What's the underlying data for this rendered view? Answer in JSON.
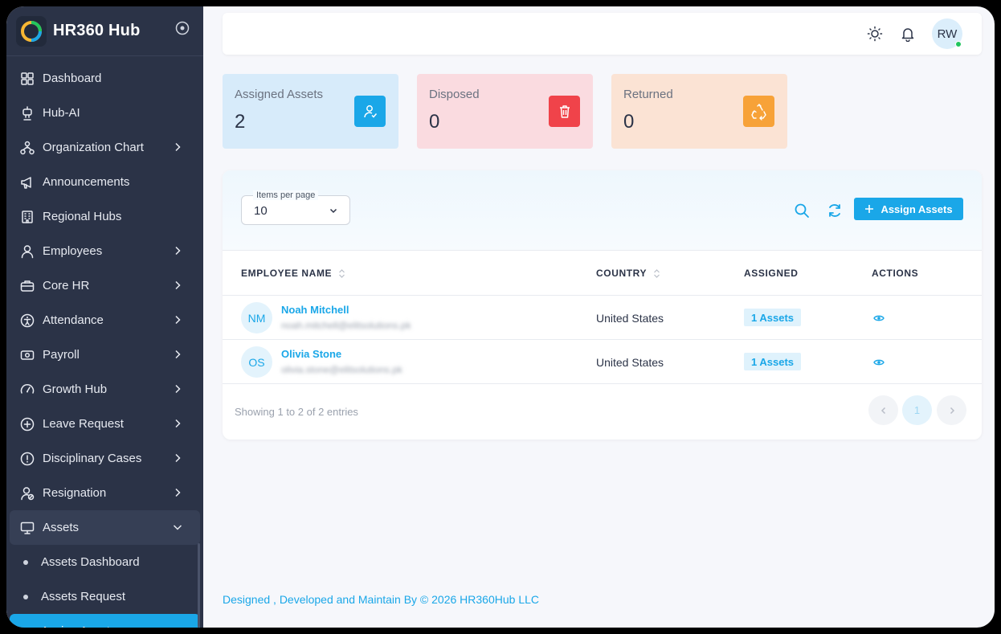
{
  "app": {
    "name": "HR360 Hub"
  },
  "sidebar": {
    "items": [
      {
        "label": "Dashboard",
        "icon": "dashboard-icon",
        "has_chevron": false
      },
      {
        "label": "Hub-AI",
        "icon": "robot-icon",
        "has_chevron": false
      },
      {
        "label": "Organization Chart",
        "icon": "org-chart-icon",
        "has_chevron": true
      },
      {
        "label": "Announcements",
        "icon": "megaphone-icon",
        "has_chevron": false
      },
      {
        "label": "Regional Hubs",
        "icon": "building-icon",
        "has_chevron": false
      },
      {
        "label": "Employees",
        "icon": "user-icon",
        "has_chevron": true
      },
      {
        "label": "Core HR",
        "icon": "briefcase-icon",
        "has_chevron": true
      },
      {
        "label": "Attendance",
        "icon": "accessibility-icon",
        "has_chevron": true
      },
      {
        "label": "Payroll",
        "icon": "money-icon",
        "has_chevron": true
      },
      {
        "label": "Growth Hub",
        "icon": "gauge-icon",
        "has_chevron": true
      },
      {
        "label": "Leave Request",
        "icon": "plus-circle-icon",
        "has_chevron": true
      },
      {
        "label": "Disciplinary Cases",
        "icon": "alert-circle-icon",
        "has_chevron": true
      },
      {
        "label": "Resignation",
        "icon": "user-remove-icon",
        "has_chevron": true
      }
    ],
    "open_item": {
      "label": "Assets",
      "icon": "monitor-icon"
    },
    "sub_items": [
      {
        "label": "Assets Dashboard"
      },
      {
        "label": "Assets Request"
      },
      {
        "label": "Assign Assets",
        "active": true
      }
    ]
  },
  "topbar": {
    "avatar_initials": "RW"
  },
  "stats": [
    {
      "label": "Assigned Assets",
      "value": "2",
      "bg": "#d7ebfa",
      "icon_bg": "#1aa7e8",
      "icon": "user-check-icon"
    },
    {
      "label": "Disposed",
      "value": "0",
      "bg": "#fadbe0",
      "icon_bg": "#f0434a",
      "icon": "trash-icon"
    },
    {
      "label": "Returned",
      "value": "0",
      "bg": "#fbe3d4",
      "icon_bg": "#f7a238",
      "icon": "recycle-icon"
    }
  ],
  "table": {
    "items_per_page_label": "Items per page",
    "items_per_page_value": "10",
    "assign_button": "Assign Assets",
    "headers": {
      "employee": "EMPLOYEE NAME",
      "country": "COUNTRY",
      "assigned": "ASSIGNED",
      "actions": "ACTIONS"
    },
    "rows": [
      {
        "initials": "NM",
        "name": "Noah Mitchell",
        "email": "noah.mitchell@elitsolutions.pk",
        "country": "United States",
        "assigned": "1 Assets"
      },
      {
        "initials": "OS",
        "name": "Olivia Stone",
        "email": "olivia.stone@elitsolutions.pk",
        "country": "United States",
        "assigned": "1 Assets"
      }
    ],
    "showing": "Showing 1 to 2 of 2 entries",
    "current_page": "1"
  },
  "footer": {
    "text": "Designed , Developed and Maintain By © 2026 HR360Hub LLC"
  },
  "colors": {
    "accent": "#1aa7e8",
    "sidebar_bg": "#2b3347"
  }
}
